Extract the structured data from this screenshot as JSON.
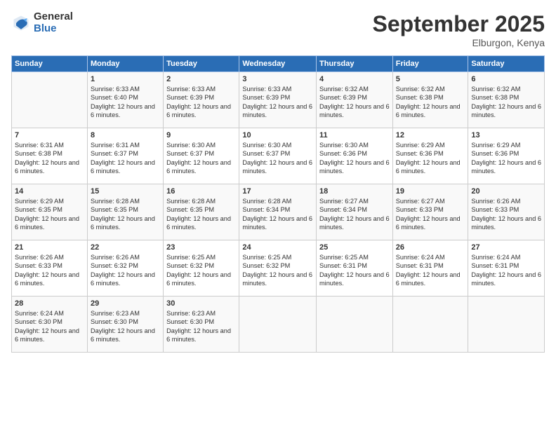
{
  "logo": {
    "general": "General",
    "blue": "Blue"
  },
  "header": {
    "month": "September 2025",
    "location": "Elburgon, Kenya"
  },
  "weekdays": [
    "Sunday",
    "Monday",
    "Tuesday",
    "Wednesday",
    "Thursday",
    "Friday",
    "Saturday"
  ],
  "weeks": [
    [
      {
        "day": "",
        "sunrise": "",
        "sunset": "",
        "daylight": ""
      },
      {
        "day": "1",
        "sunrise": "Sunrise: 6:33 AM",
        "sunset": "Sunset: 6:40 PM",
        "daylight": "Daylight: 12 hours and 6 minutes."
      },
      {
        "day": "2",
        "sunrise": "Sunrise: 6:33 AM",
        "sunset": "Sunset: 6:39 PM",
        "daylight": "Daylight: 12 hours and 6 minutes."
      },
      {
        "day": "3",
        "sunrise": "Sunrise: 6:33 AM",
        "sunset": "Sunset: 6:39 PM",
        "daylight": "Daylight: 12 hours and 6 minutes."
      },
      {
        "day": "4",
        "sunrise": "Sunrise: 6:32 AM",
        "sunset": "Sunset: 6:39 PM",
        "daylight": "Daylight: 12 hours and 6 minutes."
      },
      {
        "day": "5",
        "sunrise": "Sunrise: 6:32 AM",
        "sunset": "Sunset: 6:38 PM",
        "daylight": "Daylight: 12 hours and 6 minutes."
      },
      {
        "day": "6",
        "sunrise": "Sunrise: 6:32 AM",
        "sunset": "Sunset: 6:38 PM",
        "daylight": "Daylight: 12 hours and 6 minutes."
      }
    ],
    [
      {
        "day": "7",
        "sunrise": "Sunrise: 6:31 AM",
        "sunset": "Sunset: 6:38 PM",
        "daylight": "Daylight: 12 hours and 6 minutes."
      },
      {
        "day": "8",
        "sunrise": "Sunrise: 6:31 AM",
        "sunset": "Sunset: 6:37 PM",
        "daylight": "Daylight: 12 hours and 6 minutes."
      },
      {
        "day": "9",
        "sunrise": "Sunrise: 6:30 AM",
        "sunset": "Sunset: 6:37 PM",
        "daylight": "Daylight: 12 hours and 6 minutes."
      },
      {
        "day": "10",
        "sunrise": "Sunrise: 6:30 AM",
        "sunset": "Sunset: 6:37 PM",
        "daylight": "Daylight: 12 hours and 6 minutes."
      },
      {
        "day": "11",
        "sunrise": "Sunrise: 6:30 AM",
        "sunset": "Sunset: 6:36 PM",
        "daylight": "Daylight: 12 hours and 6 minutes."
      },
      {
        "day": "12",
        "sunrise": "Sunrise: 6:29 AM",
        "sunset": "Sunset: 6:36 PM",
        "daylight": "Daylight: 12 hours and 6 minutes."
      },
      {
        "day": "13",
        "sunrise": "Sunrise: 6:29 AM",
        "sunset": "Sunset: 6:36 PM",
        "daylight": "Daylight: 12 hours and 6 minutes."
      }
    ],
    [
      {
        "day": "14",
        "sunrise": "Sunrise: 6:29 AM",
        "sunset": "Sunset: 6:35 PM",
        "daylight": "Daylight: 12 hours and 6 minutes."
      },
      {
        "day": "15",
        "sunrise": "Sunrise: 6:28 AM",
        "sunset": "Sunset: 6:35 PM",
        "daylight": "Daylight: 12 hours and 6 minutes."
      },
      {
        "day": "16",
        "sunrise": "Sunrise: 6:28 AM",
        "sunset": "Sunset: 6:35 PM",
        "daylight": "Daylight: 12 hours and 6 minutes."
      },
      {
        "day": "17",
        "sunrise": "Sunrise: 6:28 AM",
        "sunset": "Sunset: 6:34 PM",
        "daylight": "Daylight: 12 hours and 6 minutes."
      },
      {
        "day": "18",
        "sunrise": "Sunrise: 6:27 AM",
        "sunset": "Sunset: 6:34 PM",
        "daylight": "Daylight: 12 hours and 6 minutes."
      },
      {
        "day": "19",
        "sunrise": "Sunrise: 6:27 AM",
        "sunset": "Sunset: 6:33 PM",
        "daylight": "Daylight: 12 hours and 6 minutes."
      },
      {
        "day": "20",
        "sunrise": "Sunrise: 6:26 AM",
        "sunset": "Sunset: 6:33 PM",
        "daylight": "Daylight: 12 hours and 6 minutes."
      }
    ],
    [
      {
        "day": "21",
        "sunrise": "Sunrise: 6:26 AM",
        "sunset": "Sunset: 6:33 PM",
        "daylight": "Daylight: 12 hours and 6 minutes."
      },
      {
        "day": "22",
        "sunrise": "Sunrise: 6:26 AM",
        "sunset": "Sunset: 6:32 PM",
        "daylight": "Daylight: 12 hours and 6 minutes."
      },
      {
        "day": "23",
        "sunrise": "Sunrise: 6:25 AM",
        "sunset": "Sunset: 6:32 PM",
        "daylight": "Daylight: 12 hours and 6 minutes."
      },
      {
        "day": "24",
        "sunrise": "Sunrise: 6:25 AM",
        "sunset": "Sunset: 6:32 PM",
        "daylight": "Daylight: 12 hours and 6 minutes."
      },
      {
        "day": "25",
        "sunrise": "Sunrise: 6:25 AM",
        "sunset": "Sunset: 6:31 PM",
        "daylight": "Daylight: 12 hours and 6 minutes."
      },
      {
        "day": "26",
        "sunrise": "Sunrise: 6:24 AM",
        "sunset": "Sunset: 6:31 PM",
        "daylight": "Daylight: 12 hours and 6 minutes."
      },
      {
        "day": "27",
        "sunrise": "Sunrise: 6:24 AM",
        "sunset": "Sunset: 6:31 PM",
        "daylight": "Daylight: 12 hours and 6 minutes."
      }
    ],
    [
      {
        "day": "28",
        "sunrise": "Sunrise: 6:24 AM",
        "sunset": "Sunset: 6:30 PM",
        "daylight": "Daylight: 12 hours and 6 minutes."
      },
      {
        "day": "29",
        "sunrise": "Sunrise: 6:23 AM",
        "sunset": "Sunset: 6:30 PM",
        "daylight": "Daylight: 12 hours and 6 minutes."
      },
      {
        "day": "30",
        "sunrise": "Sunrise: 6:23 AM",
        "sunset": "Sunset: 6:30 PM",
        "daylight": "Daylight: 12 hours and 6 minutes."
      },
      {
        "day": "",
        "sunrise": "",
        "sunset": "",
        "daylight": ""
      },
      {
        "day": "",
        "sunrise": "",
        "sunset": "",
        "daylight": ""
      },
      {
        "day": "",
        "sunrise": "",
        "sunset": "",
        "daylight": ""
      },
      {
        "day": "",
        "sunrise": "",
        "sunset": "",
        "daylight": ""
      }
    ]
  ]
}
